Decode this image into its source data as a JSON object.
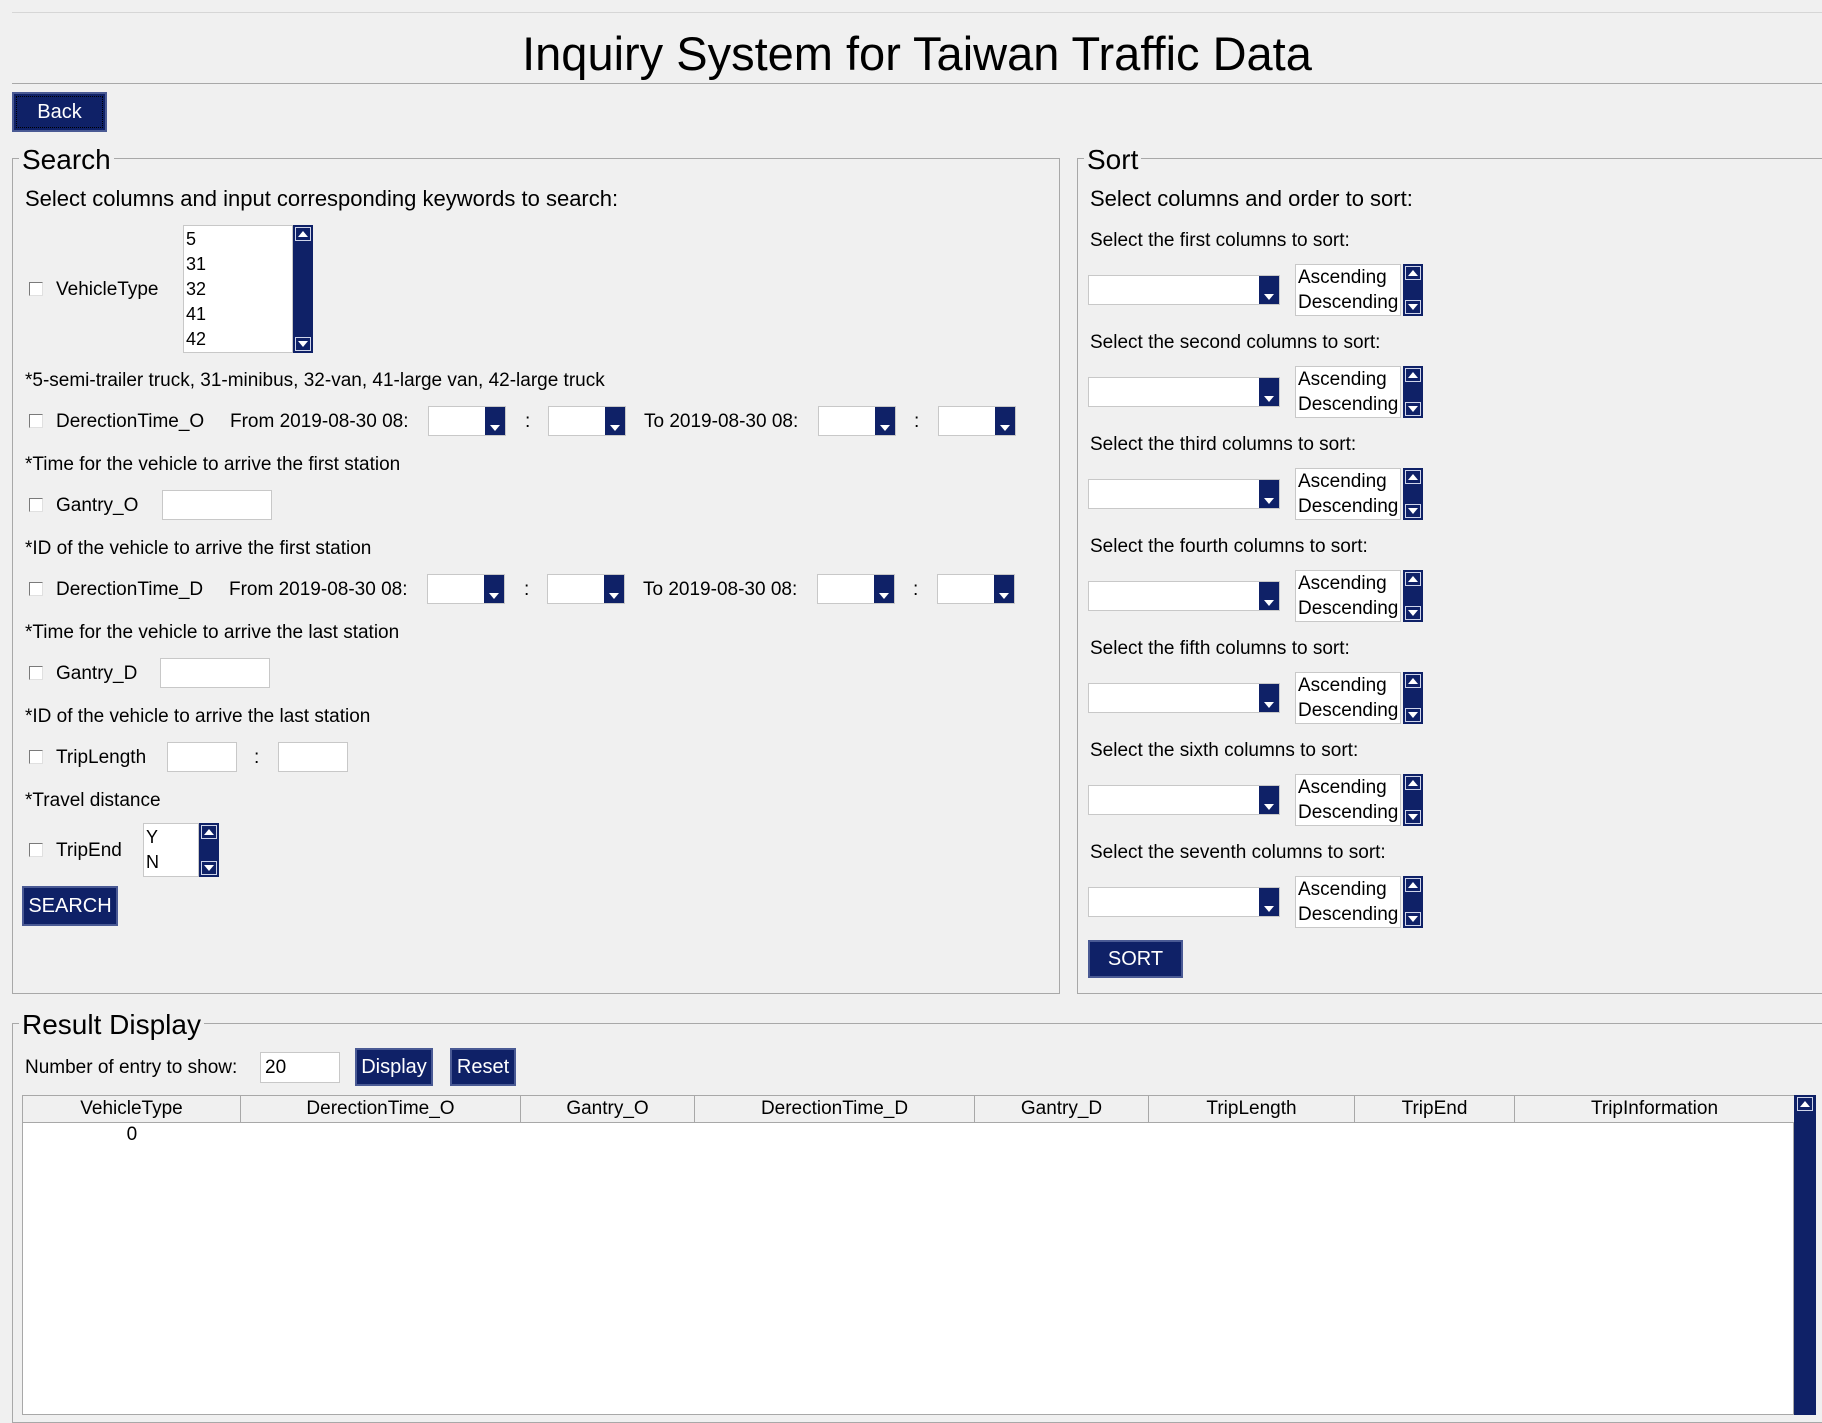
{
  "window": {
    "title": "Inquiry System for Taiwan Traffic Data"
  },
  "back_label": "Back",
  "search": {
    "title": "Search",
    "instruction": "Select columns and input corresponding keywords to search:",
    "vehicle_type": {
      "label": "VehicleType",
      "options": [
        "5",
        "31",
        "32",
        "41",
        "42"
      ],
      "note": "*5-semi-trailer truck, 31-minibus, 32-van, 41-large van, 42-large truck"
    },
    "time_o": {
      "label": "DerectionTime_O",
      "from": "From 2019-08-30 08:",
      "to": "To 2019-08-30 08:",
      "sep": ":",
      "note": "*Time for the vehicle to arrive the first station"
    },
    "gantry_o": {
      "label": "Gantry_O",
      "value": "",
      "note": "*ID of the vehicle to arrive the first station"
    },
    "time_d": {
      "label": "DerectionTime_D",
      "from": "From 2019-08-30 08:",
      "to": "To 2019-08-30 08:",
      "sep": ":",
      "note": "*Time for the vehicle to arrive the last station"
    },
    "gantry_d": {
      "label": "Gantry_D",
      "value": "",
      "note": "*ID of the vehicle to arrive the last station"
    },
    "trip_length": {
      "label": "TripLength",
      "sep": ":",
      "note": "*Travel distance"
    },
    "trip_end": {
      "label": "TripEnd",
      "options": [
        "Y",
        "N"
      ]
    },
    "button": "SEARCH"
  },
  "sort": {
    "title": "Sort",
    "instruction": "Select columns and order to sort:",
    "rows": [
      {
        "label": "Select the first columns to sort:"
      },
      {
        "label": "Select the second columns to sort:"
      },
      {
        "label": "Select the third columns to sort:"
      },
      {
        "label": "Select the fourth columns to sort:"
      },
      {
        "label": "Select the fifth columns to sort:"
      },
      {
        "label": "Select the sixth columns to sort:"
      },
      {
        "label": "Select the seventh columns to sort:"
      }
    ],
    "order_options": [
      "Ascending",
      "Descending"
    ],
    "button": "SORT"
  },
  "result": {
    "title": "Result Display",
    "entries_label": "Number of entry to show:",
    "entries_value": "20",
    "display_button": "Display",
    "reset_button": "Reset",
    "columns": [
      "VehicleType",
      "DerectionTime_O",
      "Gantry_O",
      "DerectionTime_D",
      "Gantry_D",
      "TripLength",
      "TripEnd",
      "TripInformation"
    ],
    "rows": [
      [
        "0",
        "",
        "",
        "",
        "",
        "",
        "",
        ""
      ]
    ]
  },
  "colors": {
    "accent": "#0f2167",
    "background": "#f0f0f0"
  }
}
